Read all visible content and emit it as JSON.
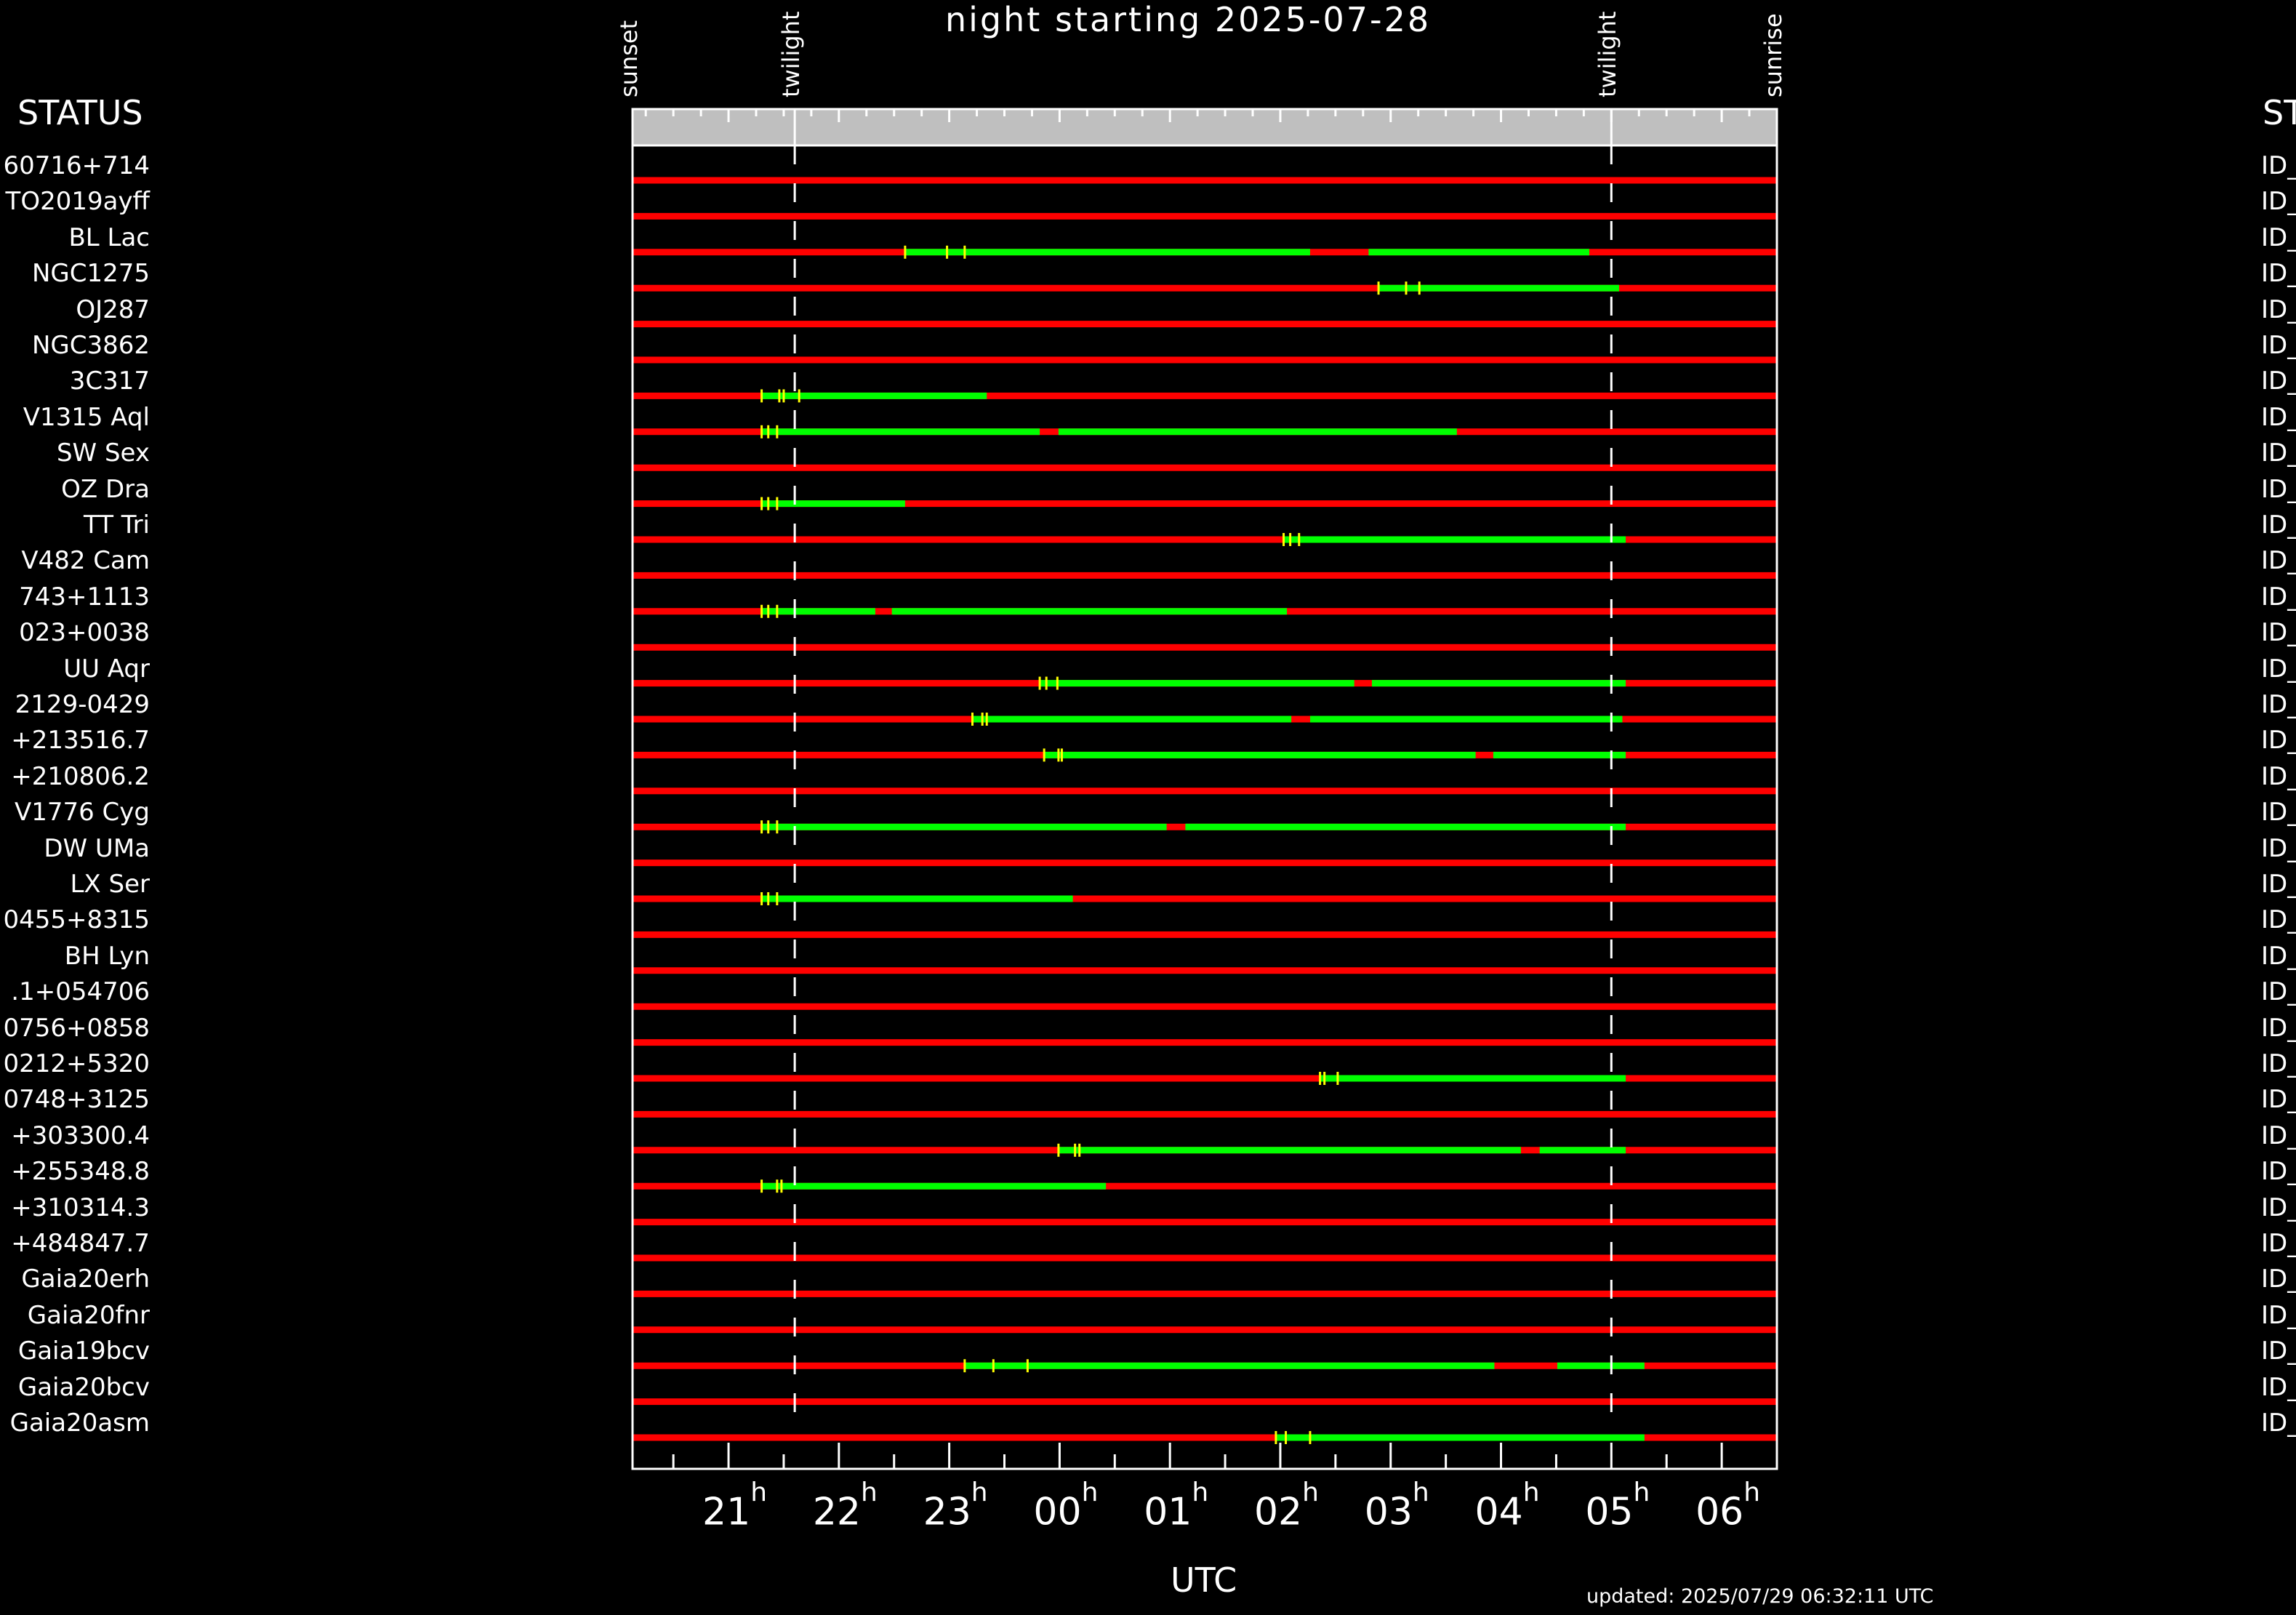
{
  "chart_data": {
    "type": "timeline",
    "title": "night starting 2025-07-28",
    "xlabel": "UTC",
    "status_header": "STATUS",
    "status_header_right": "ST",
    "updated": "updated: 2025/07/29 06:32:11 UTC",
    "time_axis": {
      "unit": "hours after 20:00 UTC",
      "start": 0.13,
      "end": 10.5,
      "tick_hours": [
        1,
        2,
        3,
        4,
        5,
        6,
        7,
        8,
        9,
        10
      ],
      "tick_labels": [
        "21",
        "22",
        "23",
        "00",
        "01",
        "02",
        "03",
        "04",
        "05",
        "06"
      ],
      "tick_suffix": "h"
    },
    "markers": [
      {
        "label": "sunset",
        "t": 0.13,
        "dashed": false
      },
      {
        "label": "twilight",
        "t": 1.6,
        "dashed": true
      },
      {
        "label": "twilight",
        "t": 9.0,
        "dashed": true
      },
      {
        "label": "sunrise",
        "t": 10.5,
        "dashed": false
      }
    ],
    "colors": {
      "unobservable": "#ff0000",
      "observable": "#00ff00",
      "tick": "#ffff00",
      "axis_band": "#bfbfbf"
    },
    "id_prefix": "ID_",
    "targets": [
      {
        "name": "60716+714",
        "green": [],
        "ticks": []
      },
      {
        "name": "TO2019ayff",
        "green": [],
        "ticks": []
      },
      {
        "name": "BL Lac",
        "green": [
          [
            2.6,
            6.27
          ],
          [
            6.8,
            8.8
          ]
        ],
        "ticks": [
          2.6,
          2.98,
          3.14
        ]
      },
      {
        "name": "NGC1275",
        "green": [
          [
            6.89,
            9.07
          ]
        ],
        "ticks": [
          6.89,
          7.14,
          7.26
        ]
      },
      {
        "name": "OJ287",
        "green": [],
        "ticks": []
      },
      {
        "name": "NGC3862",
        "green": [],
        "ticks": []
      },
      {
        "name": "3C317",
        "green": [
          [
            1.3,
            3.34
          ]
        ],
        "ticks": [
          1.3,
          1.46,
          1.5,
          1.64
        ]
      },
      {
        "name": "V1315 Aql",
        "green": [
          [
            1.3,
            3.82
          ],
          [
            3.99,
            7.6
          ]
        ],
        "ticks": [
          1.3,
          1.36,
          1.44
        ]
      },
      {
        "name": "SW Sex",
        "green": [],
        "ticks": []
      },
      {
        "name": "OZ Dra",
        "green": [
          [
            1.3,
            2.6
          ]
        ],
        "ticks": [
          1.3,
          1.36,
          1.44
        ]
      },
      {
        "name": "TT Tri",
        "green": [
          [
            6.03,
            9.13
          ]
        ],
        "ticks": [
          6.03,
          6.09,
          6.17
        ]
      },
      {
        "name": "V482 Cam",
        "green": [],
        "ticks": []
      },
      {
        "name": "743+1113",
        "green": [
          [
            1.3,
            2.33
          ],
          [
            2.48,
            6.06
          ]
        ],
        "ticks": [
          1.3,
          1.36,
          1.44
        ]
      },
      {
        "name": "023+0038",
        "green": [],
        "ticks": []
      },
      {
        "name": "UU Aqr",
        "green": [
          [
            3.82,
            6.67
          ],
          [
            6.83,
            9.13
          ]
        ],
        "ticks": [
          3.82,
          3.88,
          3.98
        ]
      },
      {
        "name": "2129-0429",
        "green": [
          [
            3.21,
            6.1
          ],
          [
            6.27,
            9.1
          ]
        ],
        "ticks": [
          3.21,
          3.3,
          3.34
        ]
      },
      {
        "name": "+213516.7",
        "green": [
          [
            3.86,
            7.77
          ],
          [
            7.93,
            9.13
          ]
        ],
        "ticks": [
          3.86,
          3.99,
          4.02
        ]
      },
      {
        "name": "+210806.2",
        "green": [],
        "ticks": []
      },
      {
        "name": "V1776 Cyg",
        "green": [
          [
            1.3,
            4.97
          ],
          [
            5.14,
            9.13
          ]
        ],
        "ticks": [
          1.3,
          1.36,
          1.44
        ]
      },
      {
        "name": "DW UMa",
        "green": [],
        "ticks": []
      },
      {
        "name": "LX Ser",
        "green": [
          [
            1.3,
            4.12
          ]
        ],
        "ticks": [
          1.3,
          1.36,
          1.44
        ]
      },
      {
        "name": "0455+8315",
        "green": [],
        "ticks": []
      },
      {
        "name": "BH Lyn",
        "green": [],
        "ticks": []
      },
      {
        "name": ".1+054706",
        "green": [],
        "ticks": []
      },
      {
        "name": "0756+0858",
        "green": [],
        "ticks": []
      },
      {
        "name": "0212+5320",
        "green": [
          [
            6.36,
            9.13
          ]
        ],
        "ticks": [
          6.36,
          6.4,
          6.52
        ]
      },
      {
        "name": "0748+3125",
        "green": [],
        "ticks": []
      },
      {
        "name": "+303300.4",
        "green": [
          [
            3.99,
            8.18
          ],
          [
            8.35,
            9.13
          ]
        ],
        "ticks": [
          3.99,
          4.14,
          4.18
        ]
      },
      {
        "name": "+255348.8",
        "green": [
          [
            1.3,
            4.42
          ]
        ],
        "ticks": [
          1.3,
          1.44,
          1.48
        ]
      },
      {
        "name": "+310314.3",
        "green": [],
        "ticks": []
      },
      {
        "name": "+484847.7",
        "green": [],
        "ticks": []
      },
      {
        "name": "Gaia20erh",
        "green": [],
        "ticks": []
      },
      {
        "name": "Gaia20fnr",
        "green": [],
        "ticks": []
      },
      {
        "name": "Gaia19bcv",
        "green": [
          [
            3.14,
            7.94
          ],
          [
            8.51,
            9.3
          ]
        ],
        "ticks": [
          3.14,
          3.4,
          3.71
        ]
      },
      {
        "name": "Gaia20bcv",
        "green": [],
        "ticks": []
      },
      {
        "name": "Gaia20asm",
        "green": [
          [
            5.96,
            9.3
          ]
        ],
        "ticks": [
          5.96,
          6.05,
          6.27
        ]
      }
    ]
  }
}
